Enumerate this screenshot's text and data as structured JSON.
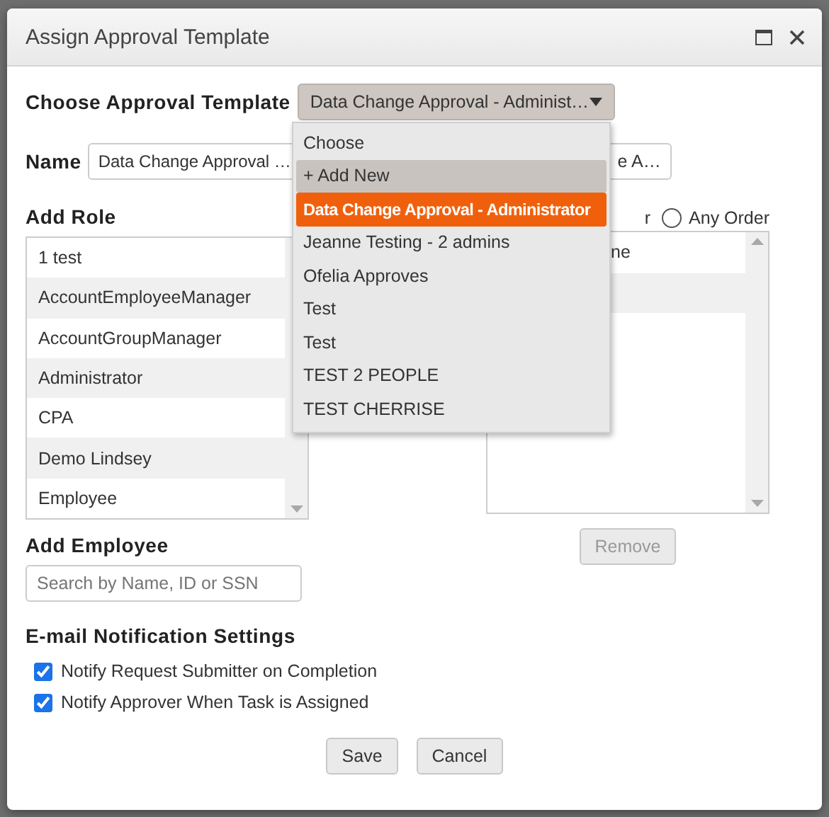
{
  "dialog": {
    "title": "Assign Approval Template"
  },
  "template": {
    "label": "Choose Approval Template",
    "value": "Data Change Approval - Administ…",
    "open": true,
    "options": [
      {
        "label": "Choose",
        "selected": false,
        "highlighted": false
      },
      {
        "label": "+ Add New",
        "selected": false,
        "highlighted": true
      },
      {
        "label": "Data Change Approval - Administrator",
        "selected": true,
        "highlighted": false
      },
      {
        "label": "Jeanne Testing - 2 admins",
        "selected": false,
        "highlighted": false
      },
      {
        "label": "Ofelia Approves",
        "selected": false,
        "highlighted": false
      },
      {
        "label": "Test",
        "selected": false,
        "highlighted": false
      },
      {
        "label": "Test",
        "selected": false,
        "highlighted": false
      },
      {
        "label": "TEST 2 PEOPLE",
        "selected": false,
        "highlighted": false
      },
      {
        "label": "TEST CHERRISE",
        "selected": false,
        "highlighted": false
      }
    ]
  },
  "name": {
    "label": "Name",
    "value": "Data Change Approval …",
    "second_value": "e A…"
  },
  "add_role": {
    "label": "Add Role",
    "items": [
      "1 test",
      "AccountEmployeeManager",
      "AccountGroupManager",
      "Administrator",
      "CPA",
      "Demo Lindsey",
      "Employee"
    ]
  },
  "order": {
    "fragment": "r",
    "options": [
      {
        "label": "Any Order",
        "selected": false
      }
    ]
  },
  "approvers": {
    "items": [
      "ne"
    ]
  },
  "remove_button": {
    "label": "Remove",
    "disabled": true
  },
  "add_employee": {
    "label": "Add Employee",
    "placeholder": "Search by Name, ID or SSN"
  },
  "email": {
    "label": "E-mail Notification Settings",
    "options": [
      {
        "label": "Notify Request Submitter on Completion",
        "checked": true
      },
      {
        "label": "Notify Approver When Task is Assigned",
        "checked": true
      }
    ]
  },
  "buttons": [
    {
      "label": "Save"
    },
    {
      "label": "Cancel"
    }
  ]
}
